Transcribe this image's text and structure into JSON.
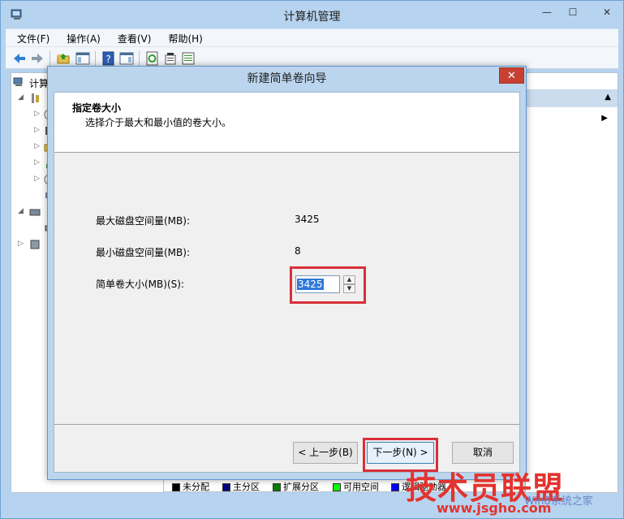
{
  "window": {
    "title": "计算机管理",
    "minimize": "—",
    "maximize": "☐",
    "close": "✕"
  },
  "menu": [
    "文件(F)",
    "操作(A)",
    "查看(V)",
    "帮助(H)"
  ],
  "tree": {
    "root_label": "计算"
  },
  "legend": [
    {
      "label": "未分配",
      "color": "#000000"
    },
    {
      "label": "主分区",
      "color": "#000080"
    },
    {
      "label": "扩展分区",
      "color": "#008000"
    },
    {
      "label": "可用空间",
      "color": "#00ff00"
    },
    {
      "label": "逻辑驱动器",
      "color": "#0000ff"
    }
  ],
  "dialog": {
    "title": "新建简单卷向导",
    "close": "✕",
    "header_title": "指定卷大小",
    "header_subtitle": "选择介于最大和最小值的卷大小。",
    "max_label": "最大磁盘空间量(MB):",
    "max_value": "3425",
    "min_label": "最小磁盘空间量(MB):",
    "min_value": "8",
    "size_label": "简单卷大小(MB)(S):",
    "size_value": "3425",
    "back_button": "< 上一步(B)",
    "next_button": "下一步(N) >",
    "cancel_button": "取消"
  },
  "watermark": {
    "brand": "技术员联盟",
    "url": "www.jsgho.com",
    "faint": "Win8系统之家"
  }
}
